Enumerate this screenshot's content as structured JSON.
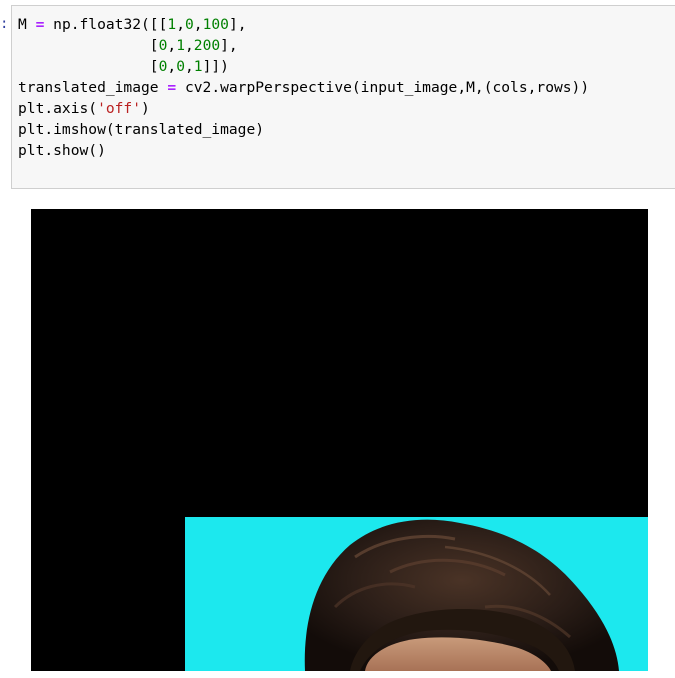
{
  "cell": {
    "prompt_marker": ":",
    "code_lines": [
      [
        {
          "t": "M ",
          "c": "plain"
        },
        {
          "t": "=",
          "c": "op"
        },
        {
          "t": " np.float32([[",
          "c": "plain"
        },
        {
          "t": "1",
          "c": "num"
        },
        {
          "t": ",",
          "c": "plain"
        },
        {
          "t": "0",
          "c": "num"
        },
        {
          "t": ",",
          "c": "plain"
        },
        {
          "t": "100",
          "c": "num"
        },
        {
          "t": "],",
          "c": "plain"
        }
      ],
      [
        {
          "t": "               [",
          "c": "plain"
        },
        {
          "t": "0",
          "c": "num"
        },
        {
          "t": ",",
          "c": "plain"
        },
        {
          "t": "1",
          "c": "num"
        },
        {
          "t": ",",
          "c": "plain"
        },
        {
          "t": "200",
          "c": "num"
        },
        {
          "t": "],",
          "c": "plain"
        }
      ],
      [
        {
          "t": "               [",
          "c": "plain"
        },
        {
          "t": "0",
          "c": "num"
        },
        {
          "t": ",",
          "c": "plain"
        },
        {
          "t": "0",
          "c": "num"
        },
        {
          "t": ",",
          "c": "plain"
        },
        {
          "t": "1",
          "c": "num"
        },
        {
          "t": "]])",
          "c": "plain"
        }
      ],
      [
        {
          "t": "translated_image ",
          "c": "plain"
        },
        {
          "t": "=",
          "c": "op"
        },
        {
          "t": " cv2.warpPerspective(input_image,M,(cols,rows))",
          "c": "plain"
        }
      ],
      [
        {
          "t": "plt.axis(",
          "c": "plain"
        },
        {
          "t": "'off'",
          "c": "str"
        },
        {
          "t": ")",
          "c": "plain"
        }
      ],
      [
        {
          "t": "plt.imshow(translated_image)",
          "c": "plain"
        }
      ],
      [
        {
          "t": "plt.show()",
          "c": "plain"
        }
      ]
    ]
  },
  "output": {
    "background_color": "#000000",
    "image_background_color": "#1ce8ee",
    "hair_color": "#2a1d17",
    "subject": "portrait-photo-translated"
  }
}
